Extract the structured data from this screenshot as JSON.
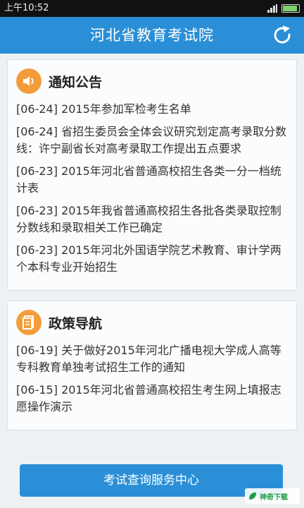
{
  "status_bar": {
    "time": "上午10:52",
    "battery_color": "#7fd16b"
  },
  "header": {
    "title": "河北省教育考试院",
    "refresh_icon": "refresh-icon",
    "color": "#2a8fd6"
  },
  "sections": [
    {
      "title": "通知公告",
      "icon": "speaker-icon",
      "items": [
        "[06-24]  2015年参加军检考生名单",
        "[06-24]  省招生委员会全体会议研究划定高考录取分数线：许宁副省长对高考录取工作提出五点要求",
        "[06-23]  2015年河北省普通高校招生各类一分一档统计表",
        "[06-23]  2015年我省普通高校招生各批各类录取控制分数线和录取相关工作已确定",
        "[06-23]  2015年河北外国语学院艺术教育、审计学两个本科专业开始招生"
      ]
    },
    {
      "title": "政策导航",
      "icon": "document-icon",
      "items": [
        "[06-19]  关于做好2015年河北广播电视大学成人高等专科教育单独考试招生工作的通知",
        "[06-15]  2015年河北省普通高校招生考生网上填报志愿操作演示"
      ]
    }
  ],
  "footer": {
    "button_label": "考试查询服务中心"
  },
  "watermark": {
    "text": "神奇下载"
  }
}
